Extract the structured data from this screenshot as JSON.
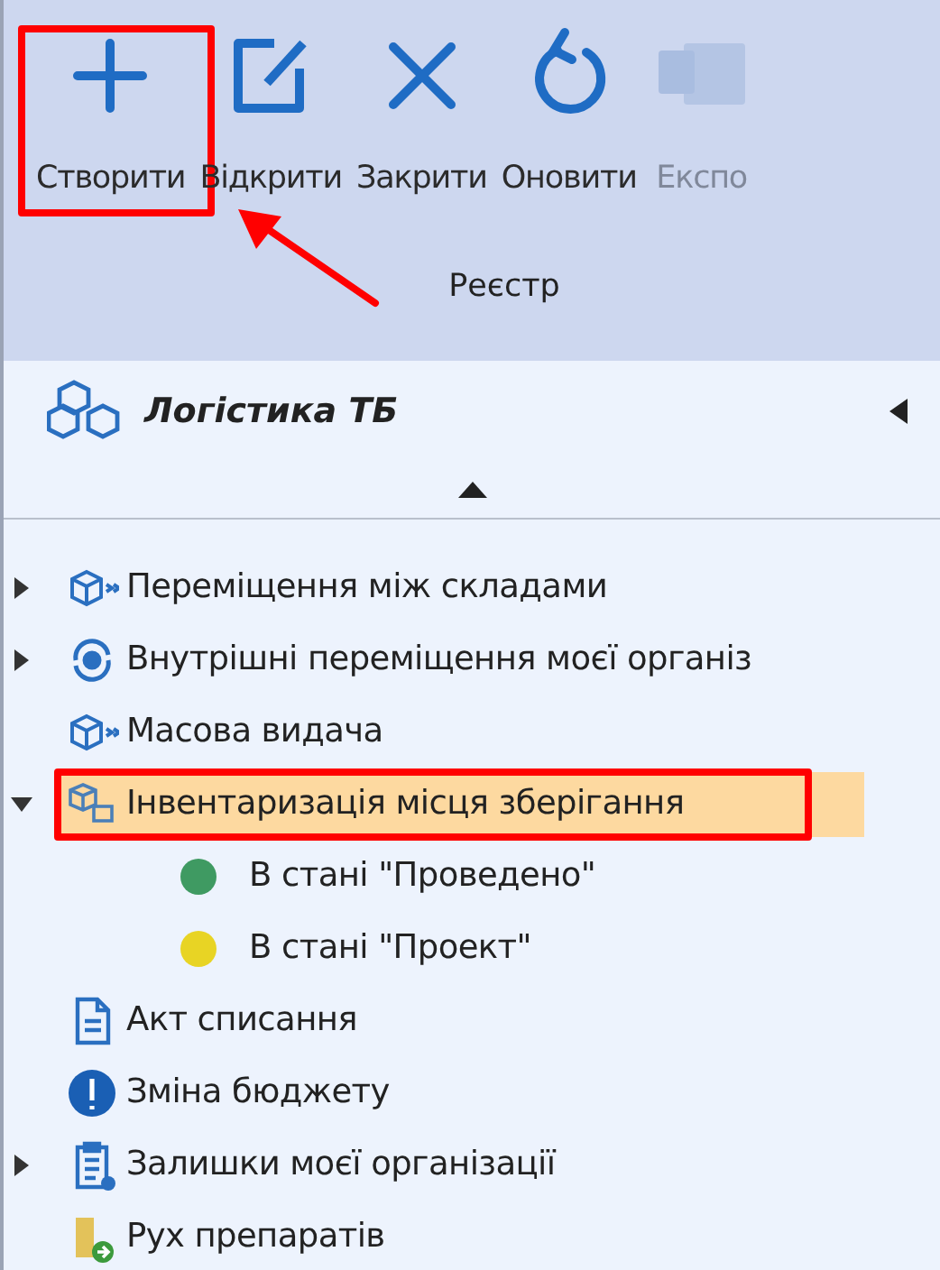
{
  "ribbon": {
    "buttons": [
      {
        "label": "Створити",
        "disabled": false,
        "highlighted": true
      },
      {
        "label": "Відкрити",
        "disabled": false,
        "highlighted": false
      },
      {
        "label": "Закрити",
        "disabled": false,
        "highlighted": false
      },
      {
        "label": "Оновити",
        "disabled": false,
        "highlighted": false
      },
      {
        "label": "Експо",
        "disabled": true,
        "highlighted": false
      }
    ],
    "group_label": "Реєстр"
  },
  "nav_panel": {
    "title": "Логістика ТБ",
    "tree": [
      {
        "label": "Переміщення між складами",
        "expanded": false,
        "selected": false,
        "highlighted": false
      },
      {
        "label": "Внутрішні переміщення моєї організ",
        "expanded": false,
        "selected": false,
        "highlighted": false
      },
      {
        "label": "Масова видача",
        "selected": false,
        "highlighted": false
      },
      {
        "label": "Інвентаризація місця зберігання",
        "expanded": true,
        "selected": true,
        "highlighted": true,
        "children": [
          {
            "label": "В стані \"Проведено\"",
            "color": "#3f9a62"
          },
          {
            "label": "В стані \"Проект\"",
            "color": "#e8d424"
          }
        ]
      },
      {
        "label": "Акт списання",
        "selected": false,
        "highlighted": false
      },
      {
        "label": "Зміна бюджету",
        "selected": false,
        "highlighted": false
      },
      {
        "label": "Залишки моєї організації",
        "expanded": false,
        "selected": false,
        "highlighted": false
      },
      {
        "label": "Рух препаратів",
        "selected": false,
        "highlighted": false
      }
    ]
  }
}
